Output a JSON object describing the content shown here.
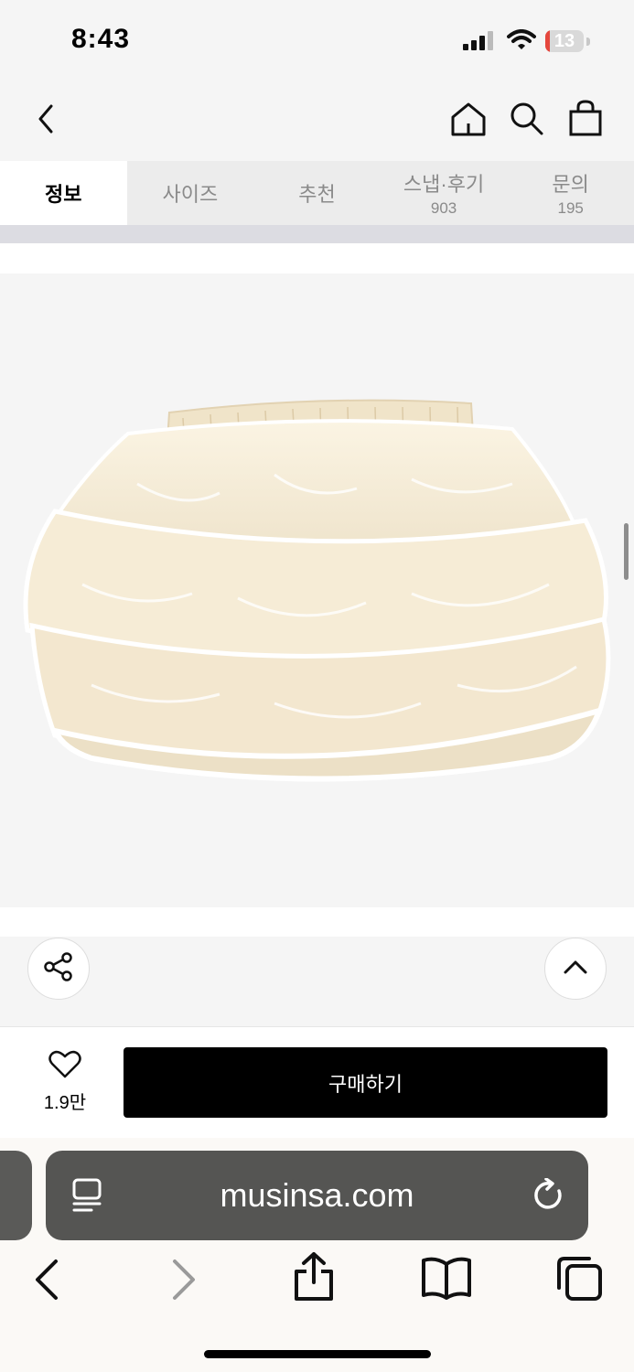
{
  "status_bar": {
    "time": "8:43",
    "battery": "13",
    "battery_level": 0.13
  },
  "header": {
    "icons": [
      "back-icon",
      "home-icon",
      "search-icon",
      "shopping-bag-icon"
    ]
  },
  "tabs": [
    {
      "label": "정보",
      "count": "",
      "active": true
    },
    {
      "label": "사이즈",
      "count": "",
      "active": false
    },
    {
      "label": "추천",
      "count": "",
      "active": false
    },
    {
      "label": "스냅·후기",
      "count": "903",
      "active": false
    },
    {
      "label": "문의",
      "count": "195",
      "active": false
    }
  ],
  "product": {
    "image": "cream-tiered-ruffle-tutu-skirt"
  },
  "actions": {
    "share_icon": "share-icon",
    "scroll_top_icon": "chevron-up-icon"
  },
  "buy_bar": {
    "like_count": "1.9만",
    "buy_label": "구매하기"
  },
  "browser": {
    "url": "musinsa.com"
  },
  "colors": {
    "buy_button": "#000000",
    "url_bar": "#555553",
    "active_tab_bg": "#ffffff"
  }
}
